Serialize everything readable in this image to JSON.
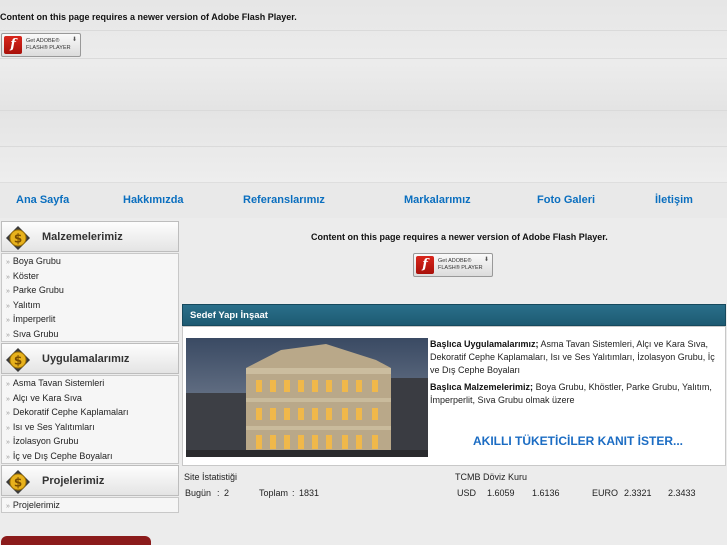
{
  "flash": {
    "message": "Content on this page requires a newer version of Adobe Flash Player.",
    "button_line1": "Get ADOBE®",
    "button_line2": "FLASH® PLAYER",
    "button_icon": "flash-player-icon"
  },
  "nav": {
    "items": [
      {
        "label": "Ana Sayfa"
      },
      {
        "label": "Hakkımızda"
      },
      {
        "label": "Referanslarımız"
      },
      {
        "label": "Markalarımız"
      },
      {
        "label": "Foto Galeri"
      },
      {
        "label": "İletişim"
      }
    ],
    "color": "#0b6fbf"
  },
  "sidebar": {
    "icon": "dollar-coin-icon",
    "sections": [
      {
        "title": "Malzemelerimiz",
        "items": [
          "Boya Grubu",
          "Köster",
          "Parke Grubu",
          "Yalıtım",
          "İmperperlit",
          "Sıva Grubu"
        ]
      },
      {
        "title": "Uygulamalarımız",
        "items": [
          "Asma Tavan Sistemleri",
          "Alçı ve Kara Sıva",
          "Dekoratif Cephe Kaplamaları",
          "Isı ve Ses Yalıtımları",
          "İzolasyon Grubu",
          "İç ve Dış Cephe Boyaları"
        ]
      },
      {
        "title": "Projelerimiz",
        "items": [
          "Projelerimiz"
        ]
      }
    ]
  },
  "panel": {
    "title": "Sedef Yapı İnşaat",
    "header_color": "#2a6f8a",
    "p1_bold": "Başlıca Uygulamalarımız;",
    "p1_text": " Asma Tavan Sistemleri, Alçı ve Kara Sıva, Dekoratif Cephe Kaplamaları, Isı ve Ses Yalıtımları, İzolasyon Grubu, İç ve Dış Cephe Boyaları",
    "p2_bold": "Başlıca Malzemelerimiz;",
    "p2_text": " Boya Grubu, Khöstler, Parke Grubu, Yalıtım, İmperperlit, Sıva Grubu olmak üzere",
    "slogan": "AKILLI TÜKETİCİLER KANIT İSTER..."
  },
  "stats": {
    "site_title": "Site İstatistiği",
    "today_label": "Bugün",
    "today_sep": ":",
    "today_value": "2",
    "total_label": "Toplam",
    "total_sep": ":",
    "total_value": "1831"
  },
  "currency": {
    "title": "TCMB Döviz Kuru",
    "usd_label": "USD",
    "usd_buy": "1.6059",
    "usd_sell": "1.6136",
    "euro_label": "EURO",
    "euro_buy": "2.3321",
    "euro_sell": "2.3433"
  }
}
